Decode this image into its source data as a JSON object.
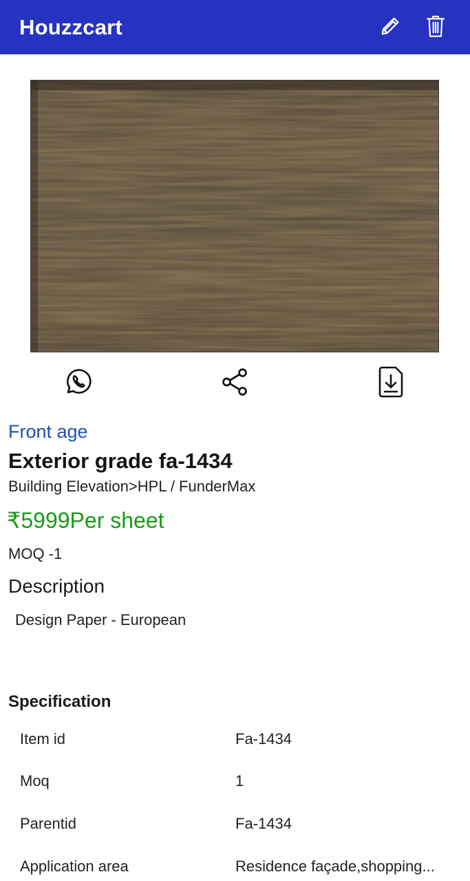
{
  "app": {
    "title": "Houzzcart",
    "brand_color": "#2633c1"
  },
  "header_actions": {
    "edit_icon": "pencil-icon",
    "delete_icon": "trash-icon"
  },
  "actions": {
    "whatsapp_icon": "whatsapp-icon",
    "share_icon": "share-icon",
    "download_icon": "download-file-icon"
  },
  "product": {
    "category": "Front age",
    "name": "Exterior grade fa-1434",
    "breadcrumb": "Building Elevation>HPL / FunderMax",
    "price": "₹5999Per sheet",
    "price_color": "#1a9a1a",
    "moq": "MOQ -1",
    "description_heading": "Description",
    "description": "Design Paper - European"
  },
  "specification": {
    "heading": "Specification",
    "rows": [
      {
        "key": "Item id",
        "value": "Fa-1434"
      },
      {
        "key": "Moq",
        "value": "1"
      },
      {
        "key": "Parentid",
        "value": "Fa-1434"
      },
      {
        "key": "Application area",
        "value": "Residence façade,shopping..."
      }
    ]
  }
}
